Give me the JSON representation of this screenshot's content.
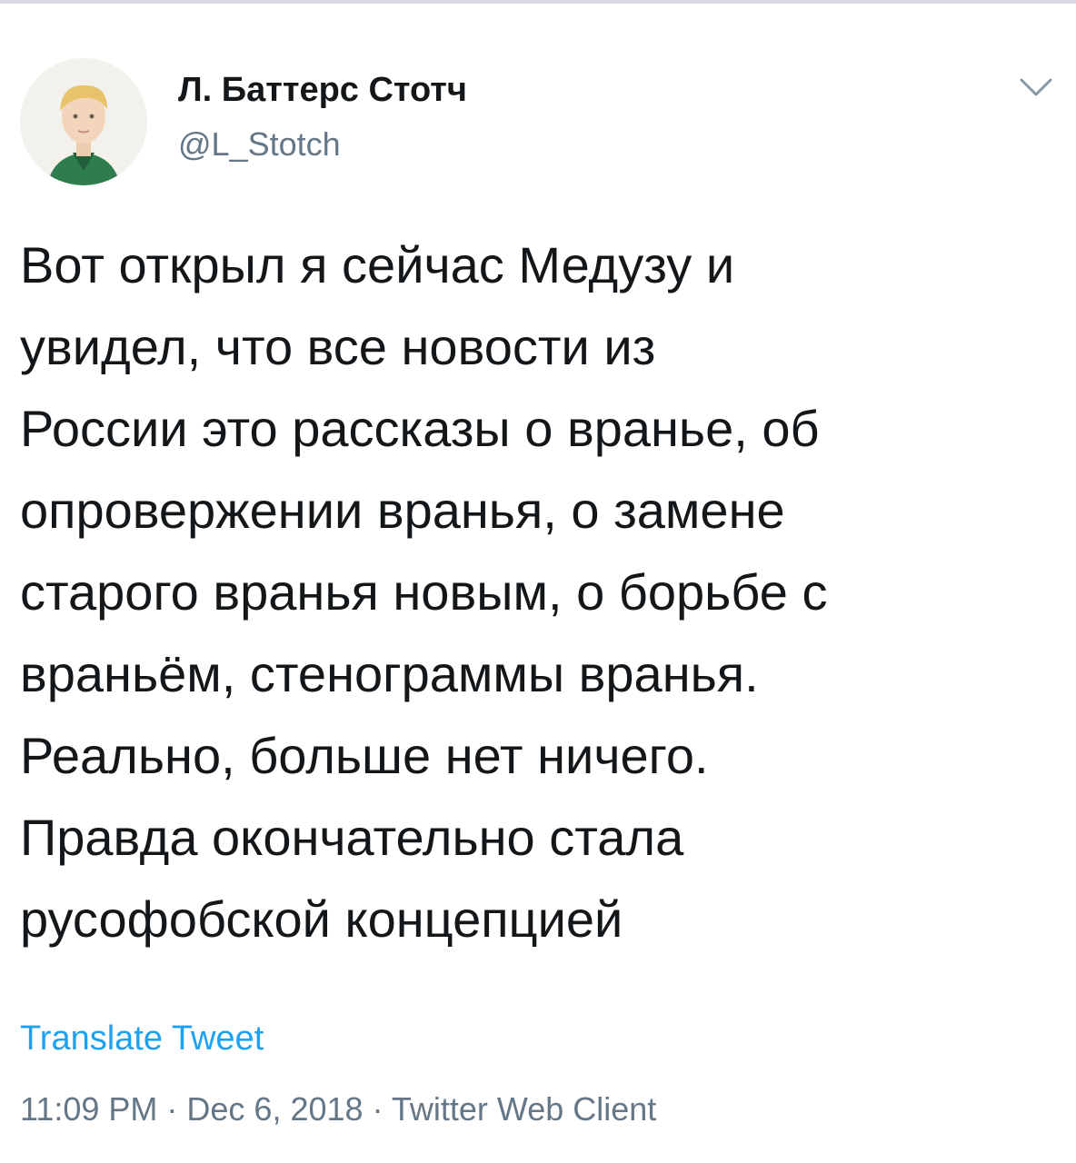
{
  "tweet": {
    "author": {
      "display_name": "Л. Баттерс Стотч",
      "handle": "@L_Stotch"
    },
    "text": "Вот открыл я сейчас Медузу и\nувидел, что все новости из\nРоссии это рассказы о вранье, об\nопровержении вранья, о замене\nстарого вранья новым, о борьбе с\nвраньём, стенограммы вранья.\nРеально, больше нет ничего.\nПравда окончательно стала\nрусофобской концепцией",
    "translate_label": "Translate Tweet",
    "meta": "11:09 PM · Dec 6, 2018 · Twitter Web Client"
  },
  "icons": {
    "menu": "chevron-down-icon"
  },
  "colors": {
    "primary_text": "#14171a",
    "secondary_text": "#657786",
    "link": "#1da1f2"
  }
}
